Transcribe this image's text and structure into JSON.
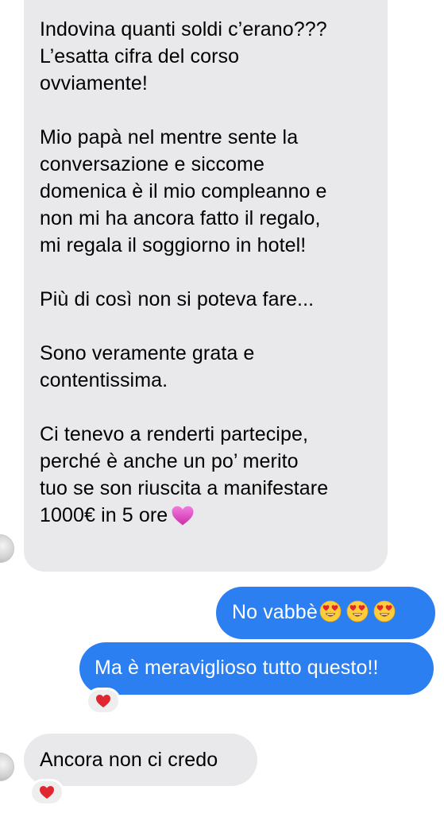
{
  "messages": {
    "incoming_long": {
      "paragraphs": [
        [
          "Indovina quanti soldi c’erano???",
          "L’esatta cifra del corso",
          "ovviamente!"
        ],
        [
          "Mio papà nel mentre sente la",
          "conversazione e siccome",
          "domenica è il mio compleanno e",
          "non mi ha ancora fatto il regalo,",
          "mi regala il soggiorno in hotel!"
        ],
        [
          "Più di così non si poteva fare..."
        ],
        [
          "Sono veramente grata e",
          "contentissima."
        ],
        [
          "Ci tenevo a renderti partecipe,",
          "perché è anche un po’ merito",
          "tuo se son riuscita a manifestare",
          "1000€ in 5 ore"
        ]
      ],
      "trailing_emoji": "purple-heart"
    },
    "outgoing_1": {
      "text": "No vabbè",
      "emojis": [
        "heart-eyes",
        "heart-eyes",
        "heart-eyes"
      ]
    },
    "outgoing_2": {
      "text": "Ma è meraviglioso tutto questo!!",
      "reaction": "red-heart"
    },
    "incoming_2": {
      "text": "Ancora non ci credo",
      "reaction": "red-heart"
    }
  },
  "colors": {
    "incoming_bubble": "#e9e9eb",
    "outgoing_bubble": "#2b7ff1",
    "outgoing_text": "#ffffff",
    "incoming_text": "#000000",
    "heart_red": "#e0262e",
    "heart_purple": "#e04fc1"
  }
}
